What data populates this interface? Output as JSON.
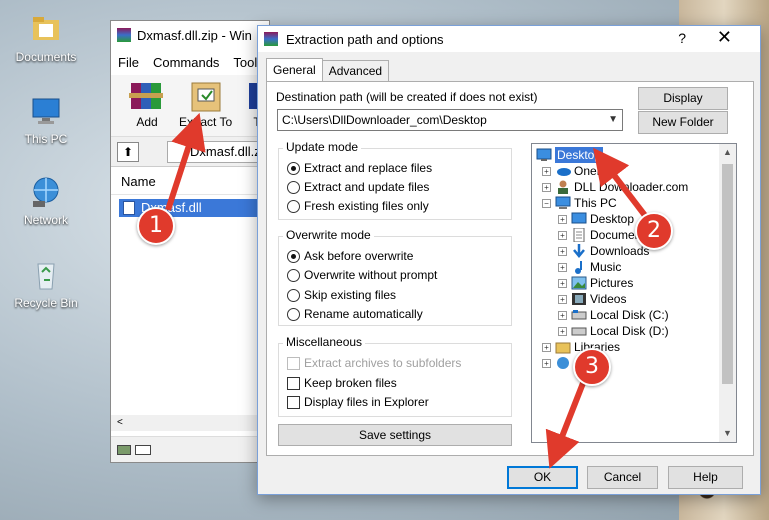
{
  "desktop": {
    "icons": [
      {
        "label": "Documents",
        "icon": "folder-documents-icon"
      },
      {
        "label": "This PC",
        "icon": "computer-icon"
      },
      {
        "label": "Network",
        "icon": "network-icon"
      },
      {
        "label": "Recycle Bin",
        "icon": "recycle-bin-icon"
      }
    ]
  },
  "winrar": {
    "title": "Dxmasf.dll.zip - Win",
    "menu": [
      "File",
      "Commands",
      "Tools"
    ],
    "toolbar": {
      "add": "Add",
      "extract_to": "Extract To",
      "extra": "T"
    },
    "address": "Dxmasf.dll.z",
    "column_name": "Name",
    "file": "Dxmasf.dll",
    "scroll_left": "<"
  },
  "dialog": {
    "title": "Extraction path and options",
    "help_glyph": "?",
    "close_glyph": "✕",
    "tabs": [
      "General",
      "Advanced"
    ],
    "dest_label": "Destination path (will be created if does not exist)",
    "dest_value": "C:\\Users\\DllDownloader_com\\Desktop",
    "display_btn": "Display",
    "new_folder_btn": "New Folder",
    "update_mode": {
      "title": "Update mode",
      "options": [
        "Extract and replace files",
        "Extract and update files",
        "Fresh existing files only"
      ],
      "selected": 0
    },
    "overwrite_mode": {
      "title": "Overwrite mode",
      "options": [
        "Ask before overwrite",
        "Overwrite without prompt",
        "Skip existing files",
        "Rename automatically"
      ],
      "selected": 0
    },
    "misc": {
      "title": "Miscellaneous",
      "options": [
        "Extract archives to subfolders",
        "Keep broken files",
        "Display files in Explorer"
      ]
    },
    "save_settings": "Save settings",
    "tree": {
      "root": "Desktop",
      "items": [
        "OneD",
        "DLL Downloader.com",
        "This PC",
        "Desktop",
        "Documents",
        "Downloads",
        "Music",
        "Pictures",
        "Videos",
        "Local Disk (C:)",
        "Local Disk (D:)",
        "Libraries",
        "N"
      ]
    },
    "ok": "OK",
    "cancel": "Cancel",
    "help": "Help"
  },
  "annotations": [
    "1",
    "2",
    "3"
  ],
  "colors": {
    "accent": "#0078d7",
    "selection": "#3b78d8",
    "marker": "#e03a2c"
  }
}
